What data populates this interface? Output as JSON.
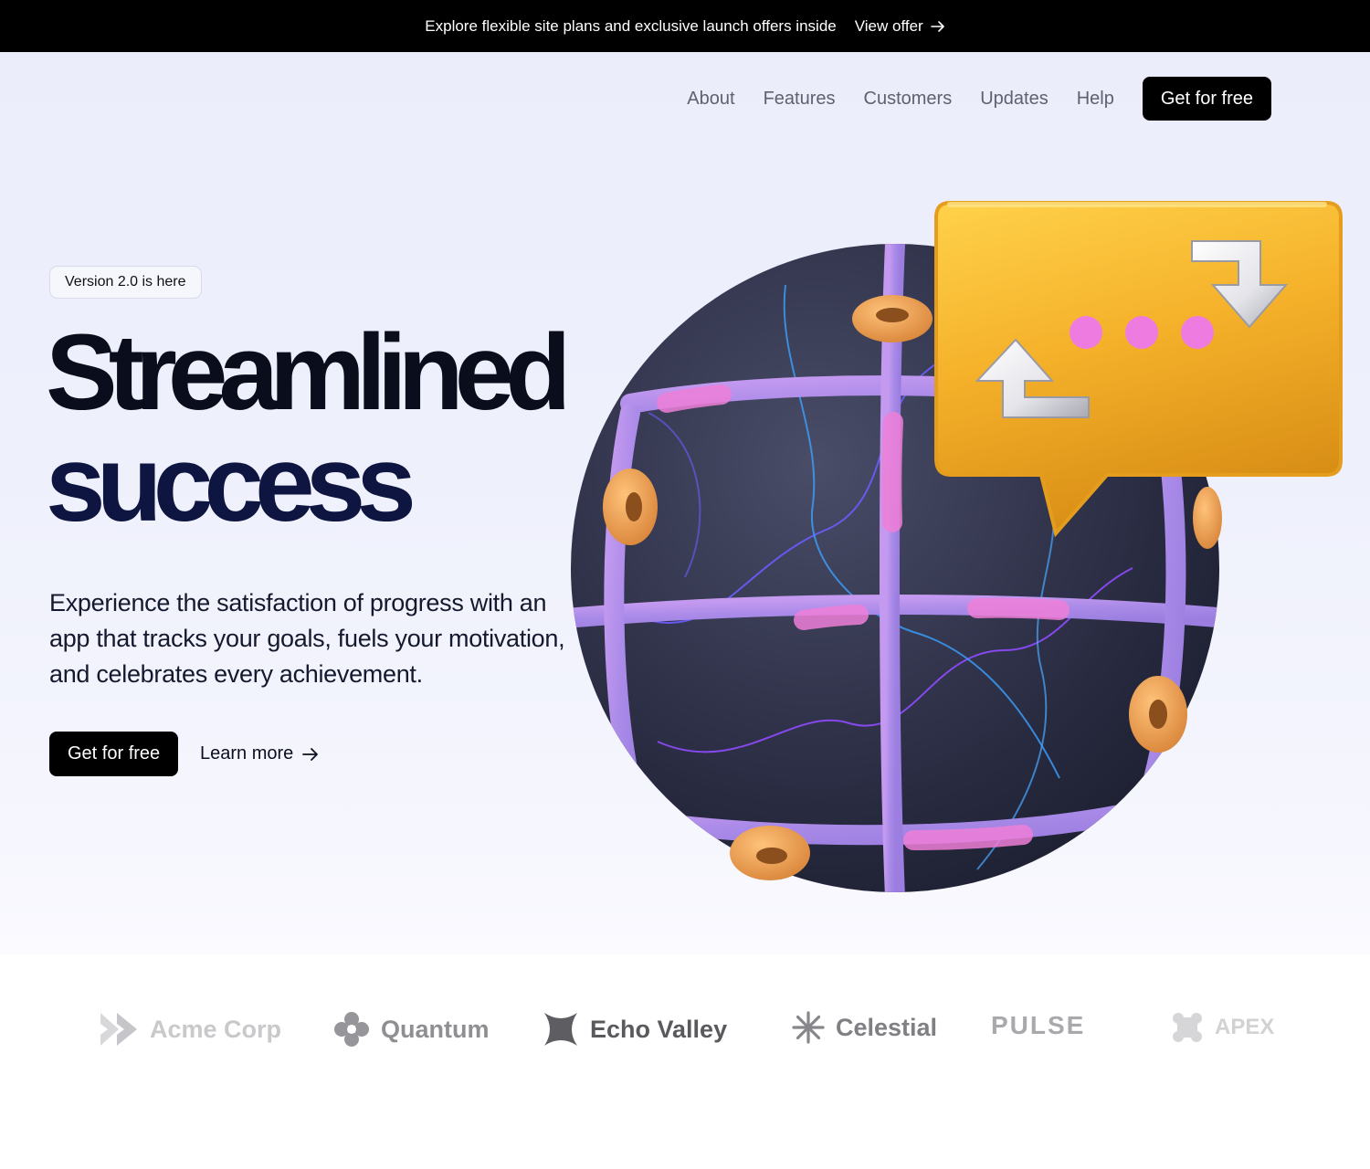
{
  "announcement": {
    "text": "Explore flexible site plans and exclusive launch offers inside",
    "link_label": "View offer",
    "link_icon": "arrow-right-icon"
  },
  "nav": {
    "links": [
      "About",
      "Features",
      "Customers",
      "Updates",
      "Help"
    ],
    "cta_label": "Get for free"
  },
  "hero": {
    "badge": "Version 2.0 is here",
    "headline_line1": "Streamlined",
    "headline_line2": "success",
    "description": "Experience the satisfaction of progress with an app that tracks your goals, fuels your motivation, and celebrates every achievement.",
    "primary_cta": "Get for free",
    "secondary_cta": "Learn more",
    "secondary_icon": "arrow-right-icon",
    "illustration": "globe-with-chat-bubble-illustration"
  },
  "logos": [
    {
      "name": "Acme Corp",
      "icon": "chevron-stack-icon",
      "color": "#c9c9cc"
    },
    {
      "name": "Quantum",
      "icon": "flower-icon",
      "color": "#8f8f93"
    },
    {
      "name": "Echo Valley",
      "icon": "x-petal-icon",
      "color": "#5a5a5e"
    },
    {
      "name": "Celestial",
      "icon": "asterisk-icon",
      "color": "#7f7f84"
    },
    {
      "name": "PULSE",
      "icon": "",
      "color": "#a9a9ad"
    },
    {
      "name": "APEX",
      "icon": "clover-icon",
      "color": "#d2d2d5"
    }
  ],
  "colors": {
    "accent": "#000000",
    "bubble_gold": "#f2ac22",
    "globe_dark": "#2c2f45",
    "grid_purple": "#a98ae8",
    "ring_orange": "#e89a4a",
    "dot_pink": "#ee7ce0"
  }
}
